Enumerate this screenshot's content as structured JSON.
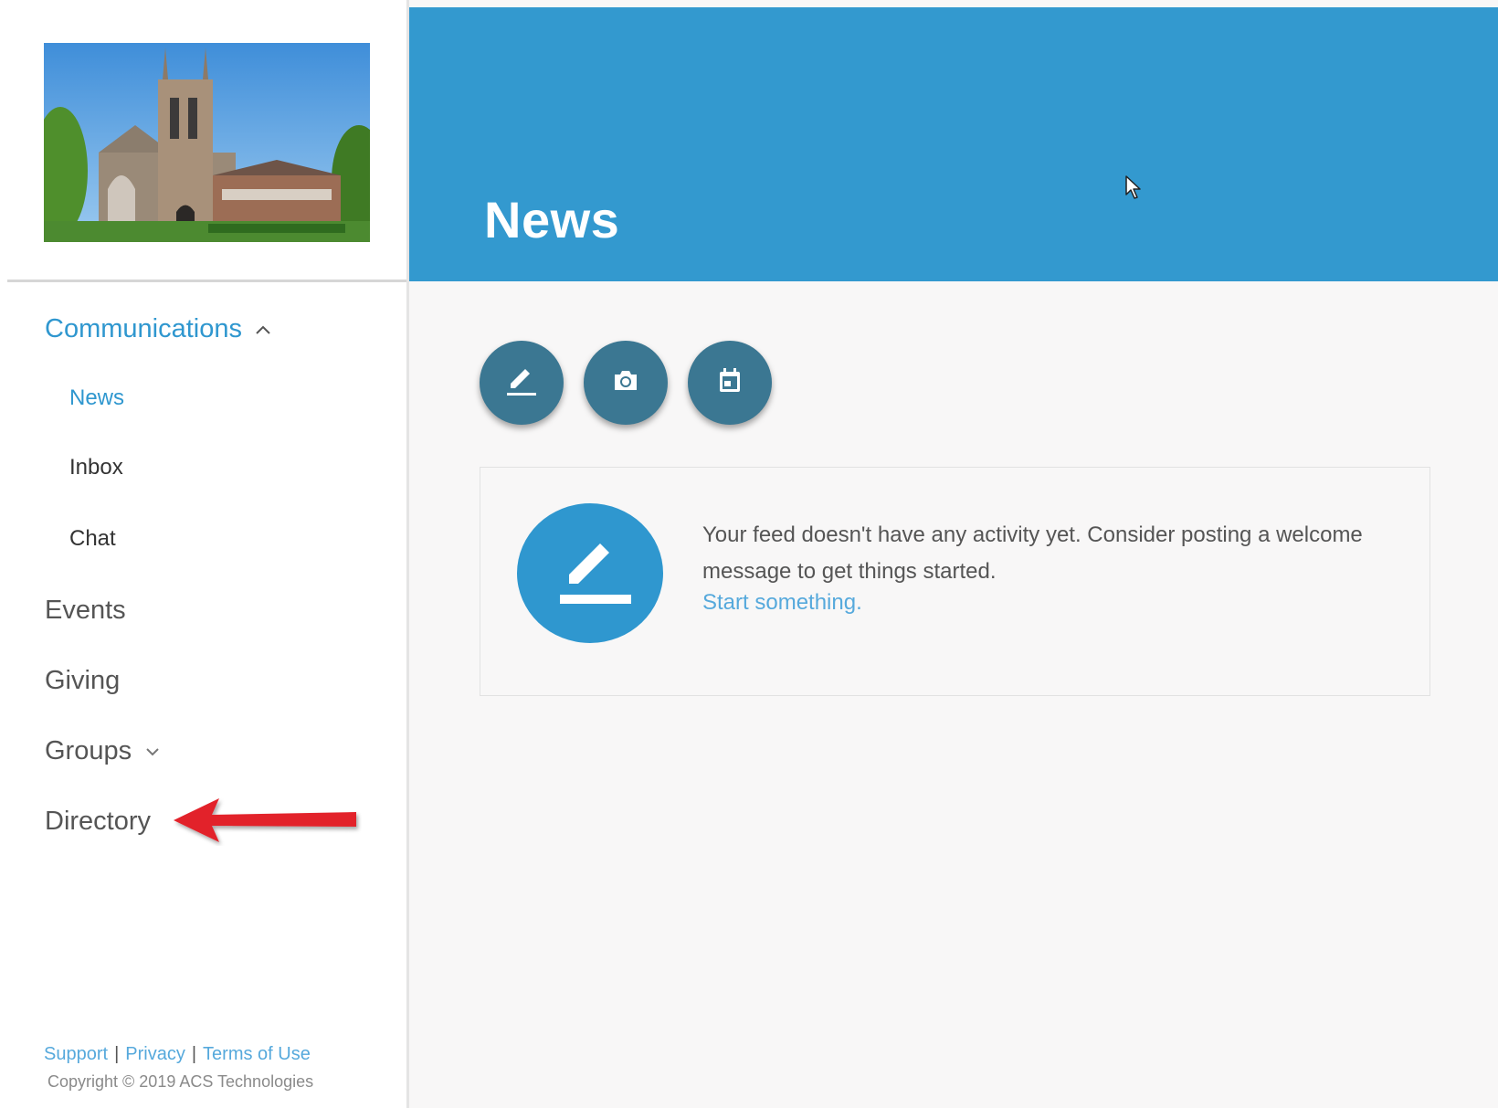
{
  "sidebar": {
    "nav": {
      "communications": "Communications",
      "news": "News",
      "inbox": "Inbox",
      "chat": "Chat",
      "events": "Events",
      "giving": "Giving",
      "groups": "Groups",
      "directory": "Directory"
    },
    "footer": {
      "support": "Support",
      "separator": "|",
      "privacy": "Privacy",
      "terms": "Terms of Use",
      "copyright": "Copyright © 2019 ACS Technologies"
    }
  },
  "header": {
    "title": "News"
  },
  "actions": [
    {
      "icon": "pencil-icon"
    },
    {
      "icon": "camera-icon"
    },
    {
      "icon": "calendar-icon"
    }
  ],
  "feed": {
    "empty_message": "Your feed doesn't have any activity yet. Consider posting a welcome message to get things started.",
    "cta": "Start something."
  },
  "colors": {
    "accent": "#3399cf",
    "action_button": "#3b7792",
    "link": "#56a9dc",
    "annotation_arrow": "#e2242b"
  }
}
